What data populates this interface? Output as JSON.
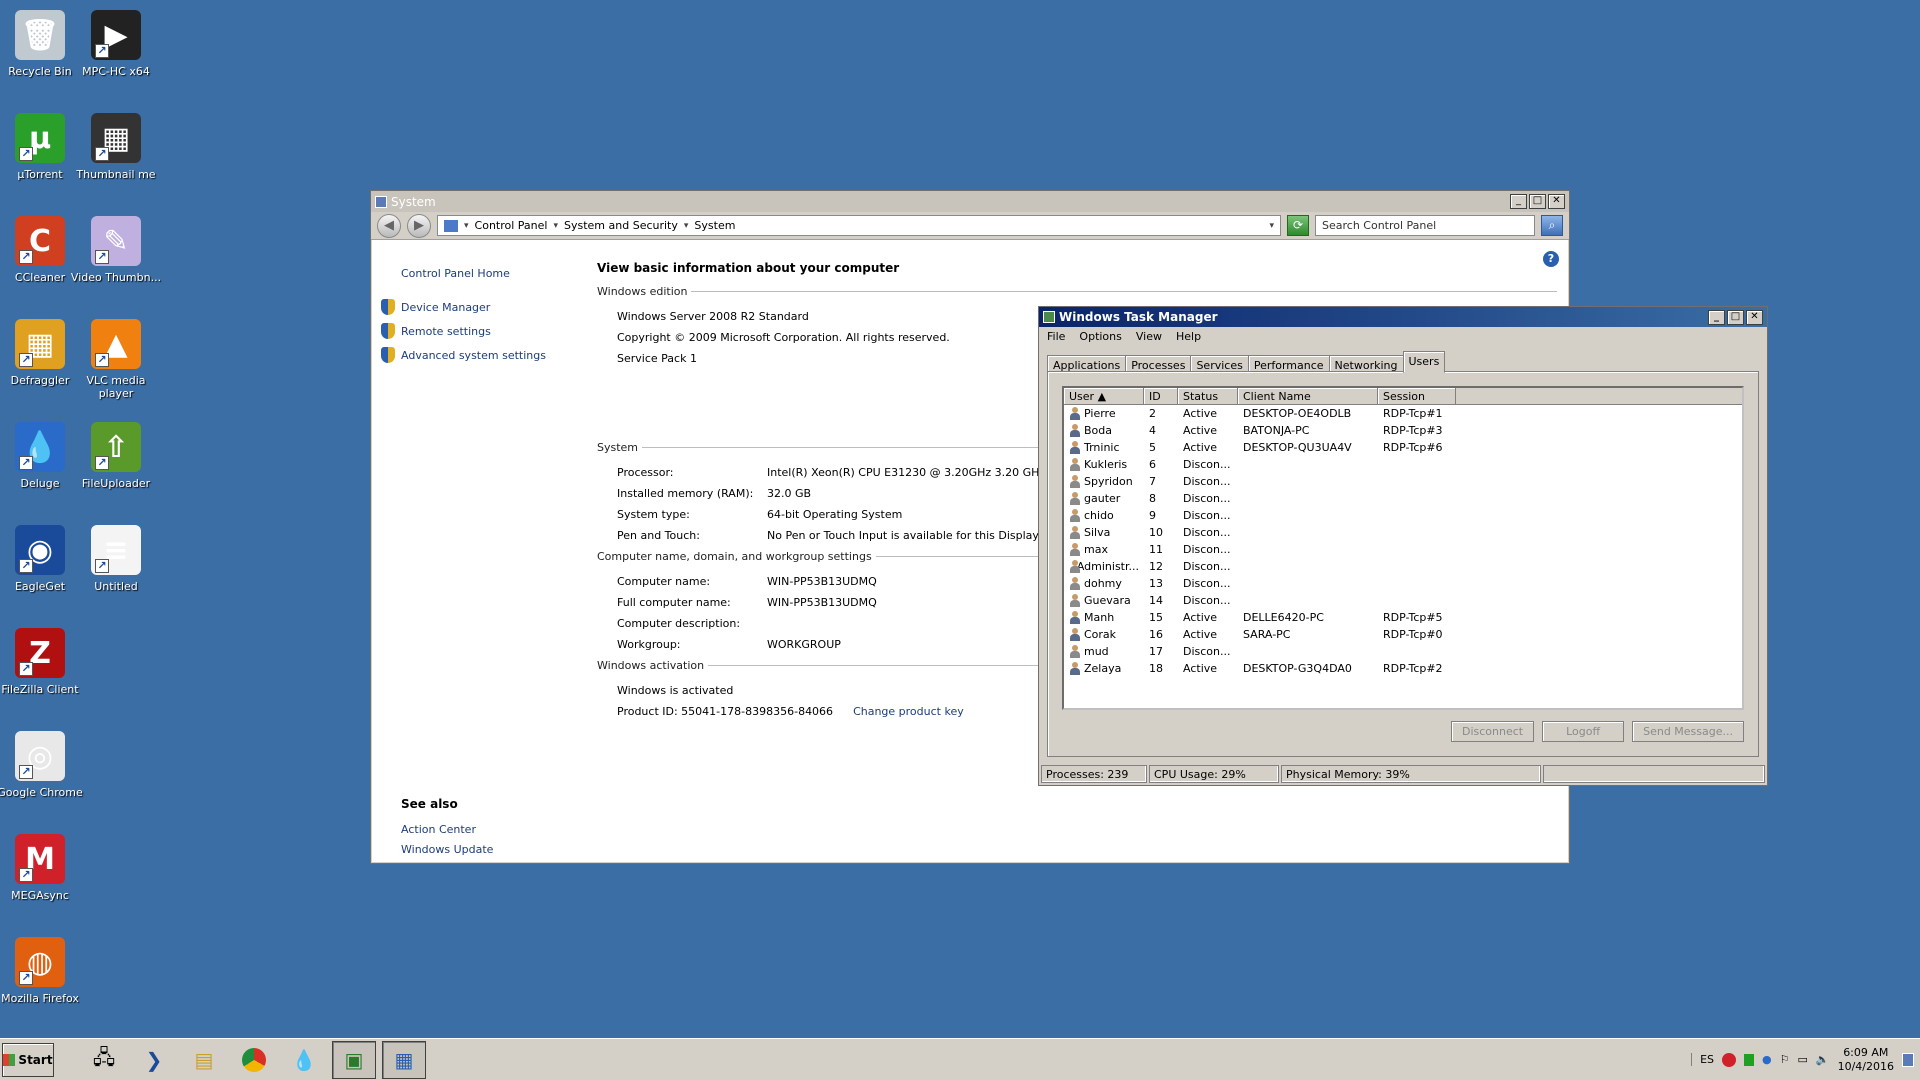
{
  "desktop": {
    "icons": [
      {
        "label": "Recycle Bin",
        "icon": "recycle-bin-icon"
      },
      {
        "label": "MPC-HC x64",
        "icon": "mpc-hc-icon"
      },
      {
        "label": "µTorrent",
        "icon": "utorrent-icon"
      },
      {
        "label": "Thumbnail me",
        "icon": "thumbnail-me-icon"
      },
      {
        "label": "CCleaner",
        "icon": "ccleaner-icon"
      },
      {
        "label": "Video Thumbn...",
        "icon": "video-thumbnailer-icon"
      },
      {
        "label": "Defraggler",
        "icon": "defraggler-icon"
      },
      {
        "label": "VLC media player",
        "icon": "vlc-icon"
      },
      {
        "label": "Deluge",
        "icon": "deluge-icon"
      },
      {
        "label": "FileUploader",
        "icon": "fileuploader-icon"
      },
      {
        "label": "EagleGet",
        "icon": "eagleget-icon"
      },
      {
        "label": "Untitled",
        "icon": "document-icon"
      },
      {
        "label": "FileZilla Client",
        "icon": "filezilla-icon"
      },
      {
        "label": "Google Chrome",
        "icon": "chrome-icon"
      },
      {
        "label": "MEGAsync",
        "icon": "megasync-icon"
      },
      {
        "label": "Mozilla Firefox",
        "icon": "firefox-icon"
      }
    ]
  },
  "system_window": {
    "title": "System",
    "breadcrumb": [
      "Control Panel",
      "System and Security",
      "System"
    ],
    "search_placeholder": "Search Control Panel",
    "left_links": {
      "home": "Control Panel Home",
      "device_manager": "Device Manager",
      "remote_settings": "Remote settings",
      "advanced": "Advanced system settings"
    },
    "see_also": {
      "heading": "See also",
      "action_center": "Action Center",
      "windows_update": "Windows Update"
    },
    "heading": "View basic information about your computer",
    "edition": {
      "section": "Windows edition",
      "name": "Windows Server 2008 R2 Standard",
      "copyright": "Copyright © 2009 Microsoft Corporation.  All rights reserved.",
      "service_pack": "Service Pack 1"
    },
    "system": {
      "section": "System",
      "rows": [
        {
          "k": "Processor:",
          "v": "Intel(R) Xeon(R) CPU E31230 @ 3.20GHz   3.20 GHz"
        },
        {
          "k": "Installed memory (RAM):",
          "v": "32.0 GB"
        },
        {
          "k": "System type:",
          "v": "64-bit Operating System"
        },
        {
          "k": "Pen and Touch:",
          "v": "No Pen or Touch Input is available for this Display"
        }
      ]
    },
    "computer": {
      "section": "Computer name, domain, and workgroup settings",
      "rows": [
        {
          "k": "Computer name:",
          "v": "WIN-PP53B13UDMQ"
        },
        {
          "k": "Full computer name:",
          "v": "WIN-PP53B13UDMQ"
        },
        {
          "k": "Computer description:",
          "v": ""
        },
        {
          "k": "Workgroup:",
          "v": "WORKGROUP"
        }
      ]
    },
    "activation": {
      "section": "Windows activation",
      "status": "Windows is activated",
      "product_id_label": "Product ID: 55041-178-8398356-84066",
      "change_key": "Change product key"
    }
  },
  "task_manager": {
    "title": "Windows Task Manager",
    "menu": [
      "File",
      "Options",
      "View",
      "Help"
    ],
    "tabs": [
      "Applications",
      "Processes",
      "Services",
      "Performance",
      "Networking",
      "Users"
    ],
    "active_tab": "Users",
    "columns": [
      "User",
      "ID",
      "Status",
      "Client Name",
      "Session"
    ],
    "rows": [
      {
        "user": "Pierre",
        "id": "2",
        "status": "Active",
        "client": "DESKTOP-OE4ODLB",
        "session": "RDP-Tcp#1"
      },
      {
        "user": "Boda",
        "id": "4",
        "status": "Active",
        "client": "BATONJA-PC",
        "session": "RDP-Tcp#3"
      },
      {
        "user": "Trninic",
        "id": "5",
        "status": "Active",
        "client": "DESKTOP-QU3UA4V",
        "session": "RDP-Tcp#6"
      },
      {
        "user": "Kukleris",
        "id": "6",
        "status": "Discon...",
        "client": "",
        "session": ""
      },
      {
        "user": "Spyridon",
        "id": "7",
        "status": "Discon...",
        "client": "",
        "session": ""
      },
      {
        "user": "gauter",
        "id": "8",
        "status": "Discon...",
        "client": "",
        "session": ""
      },
      {
        "user": "chido",
        "id": "9",
        "status": "Discon...",
        "client": "",
        "session": ""
      },
      {
        "user": "Silva",
        "id": "10",
        "status": "Discon...",
        "client": "",
        "session": ""
      },
      {
        "user": "max",
        "id": "11",
        "status": "Discon...",
        "client": "",
        "session": ""
      },
      {
        "user": "Administr...",
        "id": "12",
        "status": "Discon...",
        "client": "",
        "session": ""
      },
      {
        "user": "dohmy",
        "id": "13",
        "status": "Discon...",
        "client": "",
        "session": ""
      },
      {
        "user": "Guevara",
        "id": "14",
        "status": "Discon...",
        "client": "",
        "session": ""
      },
      {
        "user": "Manh",
        "id": "15",
        "status": "Active",
        "client": "DELLE6420-PC",
        "session": "RDP-Tcp#5"
      },
      {
        "user": "Corak",
        "id": "16",
        "status": "Active",
        "client": "SARA-PC",
        "session": "RDP-Tcp#0"
      },
      {
        "user": "mud",
        "id": "17",
        "status": "Discon...",
        "client": "",
        "session": ""
      },
      {
        "user": "Zelaya",
        "id": "18",
        "status": "Active",
        "client": "DESKTOP-G3Q4DA0",
        "session": "RDP-Tcp#2"
      }
    ],
    "buttons": {
      "disconnect": "Disconnect",
      "logoff": "Logoff",
      "send": "Send Message..."
    },
    "status": {
      "processes": "Processes: 239",
      "cpu": "CPU Usage: 29%",
      "memory": "Physical Memory: 39%"
    }
  },
  "taskbar": {
    "start": "Start",
    "lang": "ES",
    "time": "6:09 AM",
    "date": "10/4/2016"
  }
}
